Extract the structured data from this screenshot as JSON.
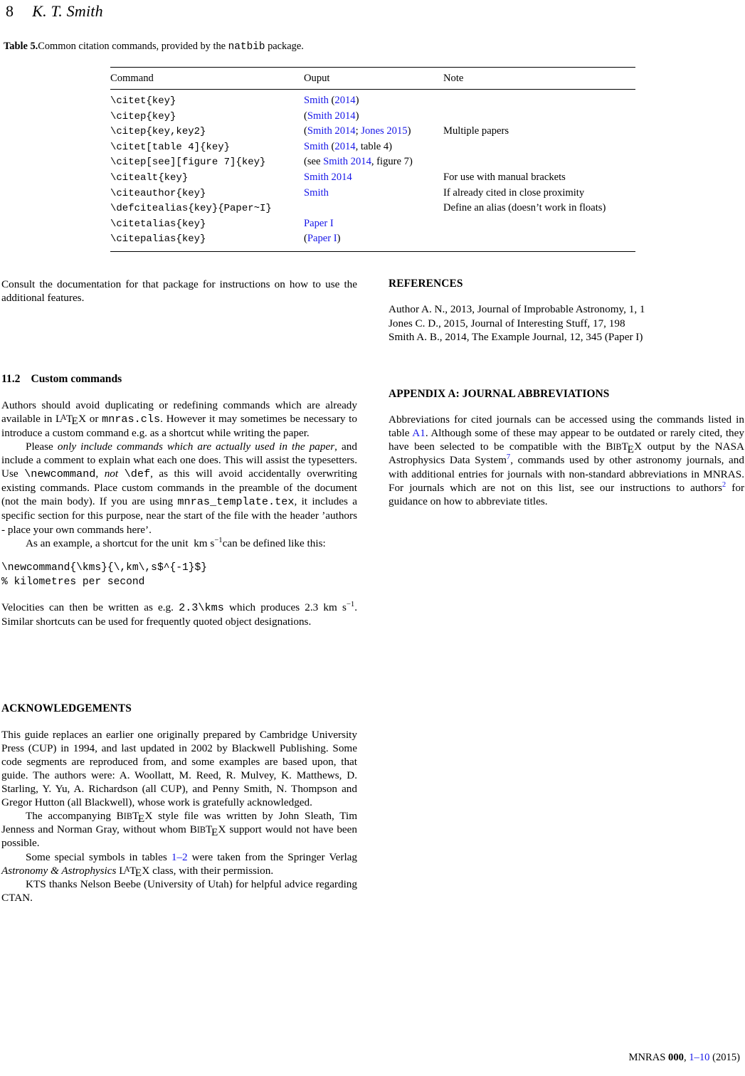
{
  "running_head": {
    "page_number": "8",
    "author": "K. T. Smith"
  },
  "table": {
    "caption_label": "Table 5.",
    "caption_text_before": "Common citation commands, provided by the ",
    "caption_code": "natbib",
    "caption_text_after": " package.",
    "headers": [
      "Command",
      "Ouput",
      "Note"
    ],
    "rows": [
      {
        "command": "\\citet{key}",
        "output_html": "<span class=\"lnk\">Smith</span> (<span class=\"lnk\">2014</span>)",
        "note": ""
      },
      {
        "command": "\\citep{key}",
        "output_html": "(<span class=\"lnk\">Smith 2014</span>)",
        "note": ""
      },
      {
        "command": "\\citep{key,key2}",
        "output_html": "(<span class=\"lnk\">Smith 2014</span>; <span class=\"lnk\">Jones 2015</span>)",
        "note": "Multiple papers"
      },
      {
        "command": "\\citet[table 4]{key}",
        "output_html": "<span class=\"lnk\">Smith</span> (<span class=\"lnk\">2014</span>, table 4)",
        "note": ""
      },
      {
        "command": "\\citep[see][figure 7]{key}",
        "output_html": "(see <span class=\"lnk\">Smith 2014</span>, figure 7)",
        "note": ""
      },
      {
        "command": "\\citealt{key}",
        "output_html": "<span class=\"lnk\">Smith 2014</span>",
        "note": "For use with manual brackets"
      },
      {
        "command": "\\citeauthor{key}",
        "output_html": "<span class=\"lnk\">Smith</span>",
        "note": "If already cited in close proximity"
      },
      {
        "command": "\\defcitealias{key}{Paper~I}",
        "output_html": "",
        "note": "Define an alias (doesn’t work in floats)"
      },
      {
        "command": "\\citetalias{key}",
        "output_html": "<span class=\"lnk\">Paper I</span>",
        "note": ""
      },
      {
        "command": "\\citepalias{key}",
        "output_html": "(<span class=\"lnk\">Paper I</span>)",
        "note": ""
      }
    ]
  },
  "left_column": {
    "consult_paragraph": "Consult the documentation for that package for instructions on how to use the additional features.",
    "section": {
      "number": "11.2",
      "title": "Custom commands"
    },
    "para1_html": "Authors should avoid duplicating or redefining commands which are already available in <span class=\"latex\">L<span class=\"a\">A</span>T<span class=\"e\">E</span>X</span> or <span class=\"mono\">mnras.cls</span>. However it may sometimes be necessary to introduce a custom command e.g. as a shortcut while writing the paper.",
    "para2_html": "Please <i>only include commands which are actually used in the paper</i>, and include a comment to explain what each one does. This will assist the typesetters. Use <span class=\"mono\">\\newcommand</span>, <i>not</i> <span class=\"mono\">\\def</span>, as this will avoid accidentally overwriting existing commands. Place custom commands in the preamble of the document (not the main body). If you are using <span class=\"mono\">mnras_template.tex</span>, it includes a specific section for this purpose, near the start of the file with the header ’authors - place your own commands here’.",
    "para3_html": "As an example, a shortcut for the unit&nbsp; <span class=\"unit\">km s<sup>−1</sup></span>can be defined like this:",
    "code_block": "\\newcommand{\\kms}{\\,km\\,s$^{-1}$}\n% kilometres per second",
    "para4_html": "Velocities can then be written as e.g. <span class=\"mono\">2.3\\kms</span> which produces <span class=\"unit\">2.3 km s<sup>−1</sup></span>. Similar shortcuts can be used for frequently quoted object designations.",
    "acknowledgements_heading": "ACKNOWLEDGEMENTS",
    "ack_para1_html": "This guide replaces an earlier one originally prepared by Cambridge University Press (CUP) in 1994, and last updated in 2002 by Blackwell Publishing. Some code segments are reproduced from, and some examples are based upon, that guide. The authors were: A. Woollatt, M. Reed, R. Mulvey, K. Matthews, D. Starling, Y. Yu, A. Richardson (all CUP), and Penny Smith, N. Thompson and Gregor Hutton (all Blackwell), whose work is gratefully acknowledged.",
    "ack_para2_html": "The accompanying <span class=\"bibtex\">B<span class=\"sc\">IB</span>T<span class=\"e\">E</span>X</span> style file was written by John Sleath, Tim Jenness and Norman Gray, without whom <span class=\"bibtex\">B<span class=\"sc\">IB</span>T<span class=\"e\">E</span>X</span> support would not have been possible.",
    "ack_para3_html": "Some special symbols in tables <span class=\"lnk\">1–2</span> were taken from the Springer Verlag <i>Astronomy &amp; Astrophysics</i> <span class=\"latex\">L<span class=\"a\">A</span>T<span class=\"e\">E</span>X</span> class, with their permission.",
    "ack_para4_html": "KTS thanks Nelson Beebe (University of Utah) for helpful advice regarding CTAN."
  },
  "right_column": {
    "references_heading": "REFERENCES",
    "references": [
      "Author A. N., 2013, Journal of Improbable Astronomy, 1, 1",
      "Jones C. D., 2015, Journal of Interesting Stuff, 17, 198",
      "Smith A. B., 2014, The Example Journal, 12, 345 (Paper I)"
    ],
    "appendix_heading": "APPENDIX A:  JOURNAL ABBREVIATIONS",
    "appendix_para_html": "Abbreviations for cited journals can be accessed using the commands listed in table <span class=\"lnk\">A1</span>. Although some of these may appear to be outdated or rarely cited, they have been selected to be compatible with the <span class=\"bibtex\">B<span class=\"sc\">IB</span>T<span class=\"e\">E</span>X</span> output by the NASA Astrophysics Data System<sup class=\"lnk\">7</sup>, commands used by other astronomy journals, and with additional entries for journals with non-standard abbreviations in MNRAS. For journals which are not on this list, see our instructions to authors<sup class=\"lnk\">2</sup> for guidance on how to abbreviate titles."
  },
  "footer": {
    "journal": "MNRAS",
    "volume": "000",
    "pages": "1–10",
    "year": "(2015)"
  },
  "colors": {
    "link": "#1616E8",
    "text": "#000000",
    "background": "#FFFFFF"
  }
}
